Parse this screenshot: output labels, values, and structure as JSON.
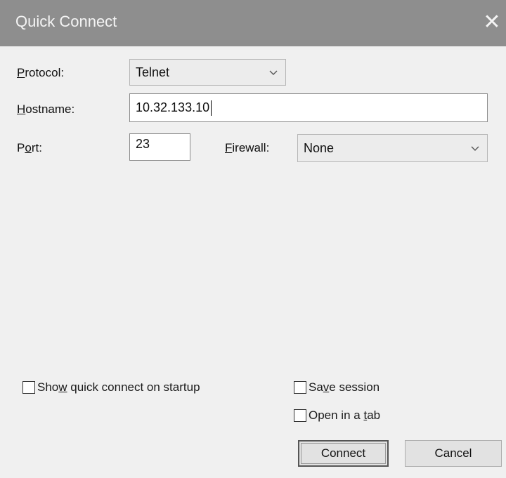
{
  "window": {
    "title": "Quick Connect",
    "close_glyph": "✕"
  },
  "form": {
    "protocol": {
      "label_prefix": "",
      "label_key": "P",
      "label_rest": "rotocol:",
      "value": "Telnet"
    },
    "hostname": {
      "label_prefix": "",
      "label_key": "H",
      "label_rest": "ostname:",
      "value": "10.32.133.10"
    },
    "port": {
      "label_prefix": "P",
      "label_key": "o",
      "label_rest": "rt:",
      "value": "23"
    },
    "firewall": {
      "label_prefix": "",
      "label_key": "F",
      "label_rest": "irewall:",
      "value": "None"
    }
  },
  "options": {
    "show_on_startup": {
      "label_prefix": "Sho",
      "label_key": "w",
      "label_rest": " quick connect on startup",
      "checked": false
    },
    "save_session": {
      "label_prefix": "Sa",
      "label_key": "v",
      "label_rest": "e session",
      "checked": false
    },
    "open_in_tab": {
      "label_prefix": "Open in a ",
      "label_key": "t",
      "label_rest": "ab",
      "checked": false
    }
  },
  "buttons": {
    "connect": "Connect",
    "cancel": "Cancel"
  },
  "icons": {
    "dropdown": "chevron-down-icon",
    "close": "close-icon"
  }
}
